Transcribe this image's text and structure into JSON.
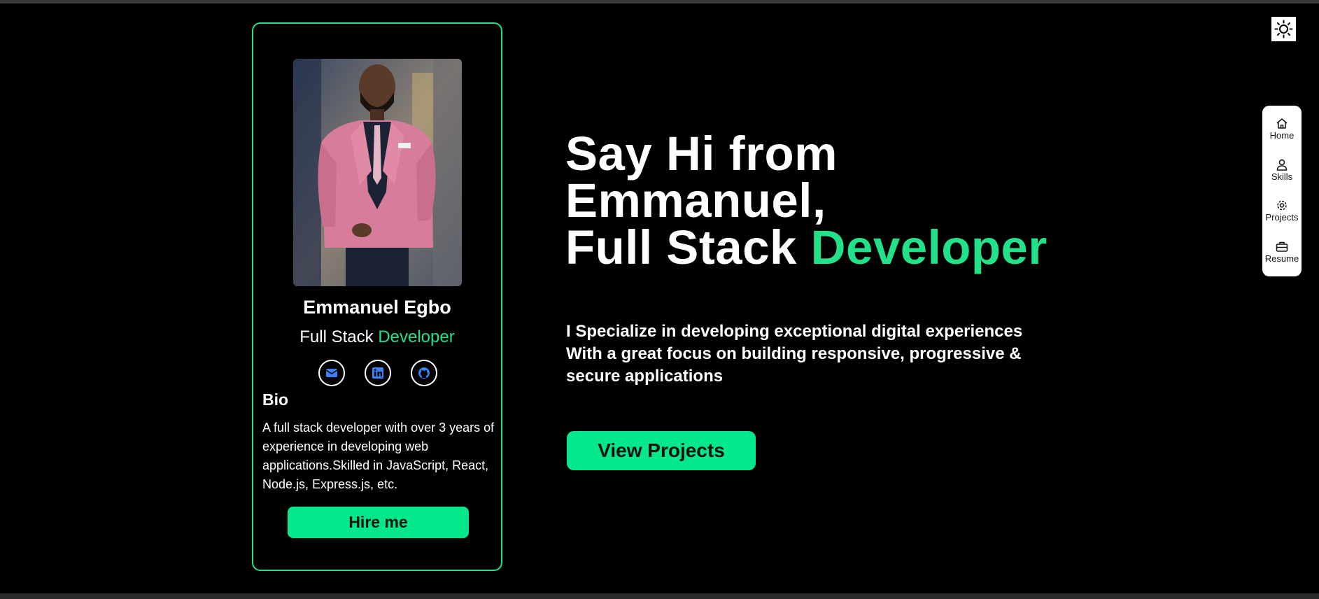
{
  "profile": {
    "name": "Emmanuel Egbo",
    "role_prefix": "Full Stack",
    "role_accent": "Developer",
    "photo_icon": "portrait-photo",
    "socials": [
      {
        "icon": "mail-icon"
      },
      {
        "icon": "linkedin-icon"
      },
      {
        "icon": "github-icon"
      }
    ],
    "bio_title": "Bio",
    "bio_text": "A full stack developer with over 3 years of experience in developing web applications.Skilled in JavaScript, React, Node.js, Express.js, etc.",
    "hire_label": "Hire me"
  },
  "hero": {
    "line1": "Say Hi from",
    "line2": "Emmanuel,",
    "line3_prefix": "Full Stack",
    "line3_accent": "Developer",
    "desc_line1": "I Specialize in developing exceptional digital experiences",
    "desc_line2": "With a great focus on building responsive, progressive &",
    "desc_line3": "secure applications",
    "cta_label": "View Projects"
  },
  "nav": {
    "items": [
      {
        "label": "Home",
        "icon": "home-icon"
      },
      {
        "label": "Skills",
        "icon": "user-icon"
      },
      {
        "label": "Projects",
        "icon": "gear-icon"
      },
      {
        "label": "Resume",
        "icon": "briefcase-icon"
      }
    ]
  },
  "theme_toggle": {
    "icon": "sun-icon"
  },
  "colors": {
    "accent": "#02e88a",
    "background": "#000000",
    "card_border": "#23e08a",
    "social_icon": "#3b82f6"
  }
}
